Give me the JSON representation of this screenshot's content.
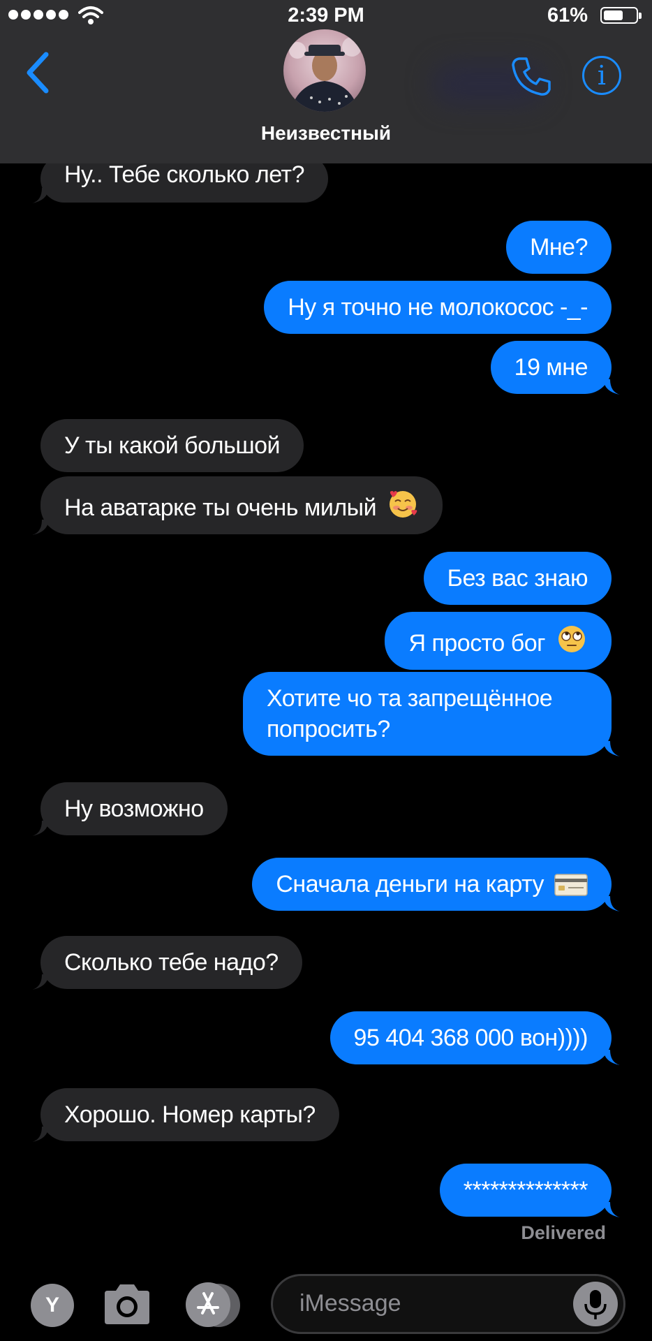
{
  "status_bar": {
    "time": "2:39 PM",
    "battery": "61%",
    "battery_level": 0.61
  },
  "header": {
    "contact_name": "Неизвестный"
  },
  "messages": [
    {
      "side": "in",
      "text": "Ну.. Тебе сколько лет?"
    },
    {
      "side": "out",
      "text": "Мне?"
    },
    {
      "side": "out",
      "text": "Ну я точно не молокосос -_-"
    },
    {
      "side": "out",
      "text": "19 мне"
    },
    {
      "side": "in",
      "text": "У ты какой большой"
    },
    {
      "side": "in",
      "text": "На аватарке ты очень милый",
      "emoji": "smiling-face-with-hearts"
    },
    {
      "side": "out",
      "text": "Без вас знаю"
    },
    {
      "side": "out",
      "text": "Я просто бог",
      "emoji": "face-with-rolling-eyes"
    },
    {
      "side": "out",
      "text": "Хотите чо та запрещённое",
      "text2": "попросить?"
    },
    {
      "side": "in",
      "text": "Ну возможно"
    },
    {
      "side": "out",
      "text": "Сначала деньги на карту",
      "emoji": "credit-card"
    },
    {
      "side": "in",
      "text": "Сколько тебе надо?"
    },
    {
      "side": "out",
      "text": "95 404 368 000 вон))))"
    },
    {
      "side": "in",
      "text": "Хорошо. Номер карты?"
    },
    {
      "side": "out",
      "text": "**************"
    }
  ],
  "delivered": "Delivered",
  "composer": {
    "placeholder": "iMessage",
    "digital_touch_letter": "Y"
  },
  "icons": {
    "back": "chevron-left-icon",
    "phone": "phone-icon",
    "info": "info-icon",
    "camera": "camera-icon",
    "appstore": "appstore-icon",
    "mic": "microphone-icon"
  },
  "colors": {
    "accent": "#0a7cff",
    "incoming": "#262628",
    "header": "#2f2f31"
  }
}
